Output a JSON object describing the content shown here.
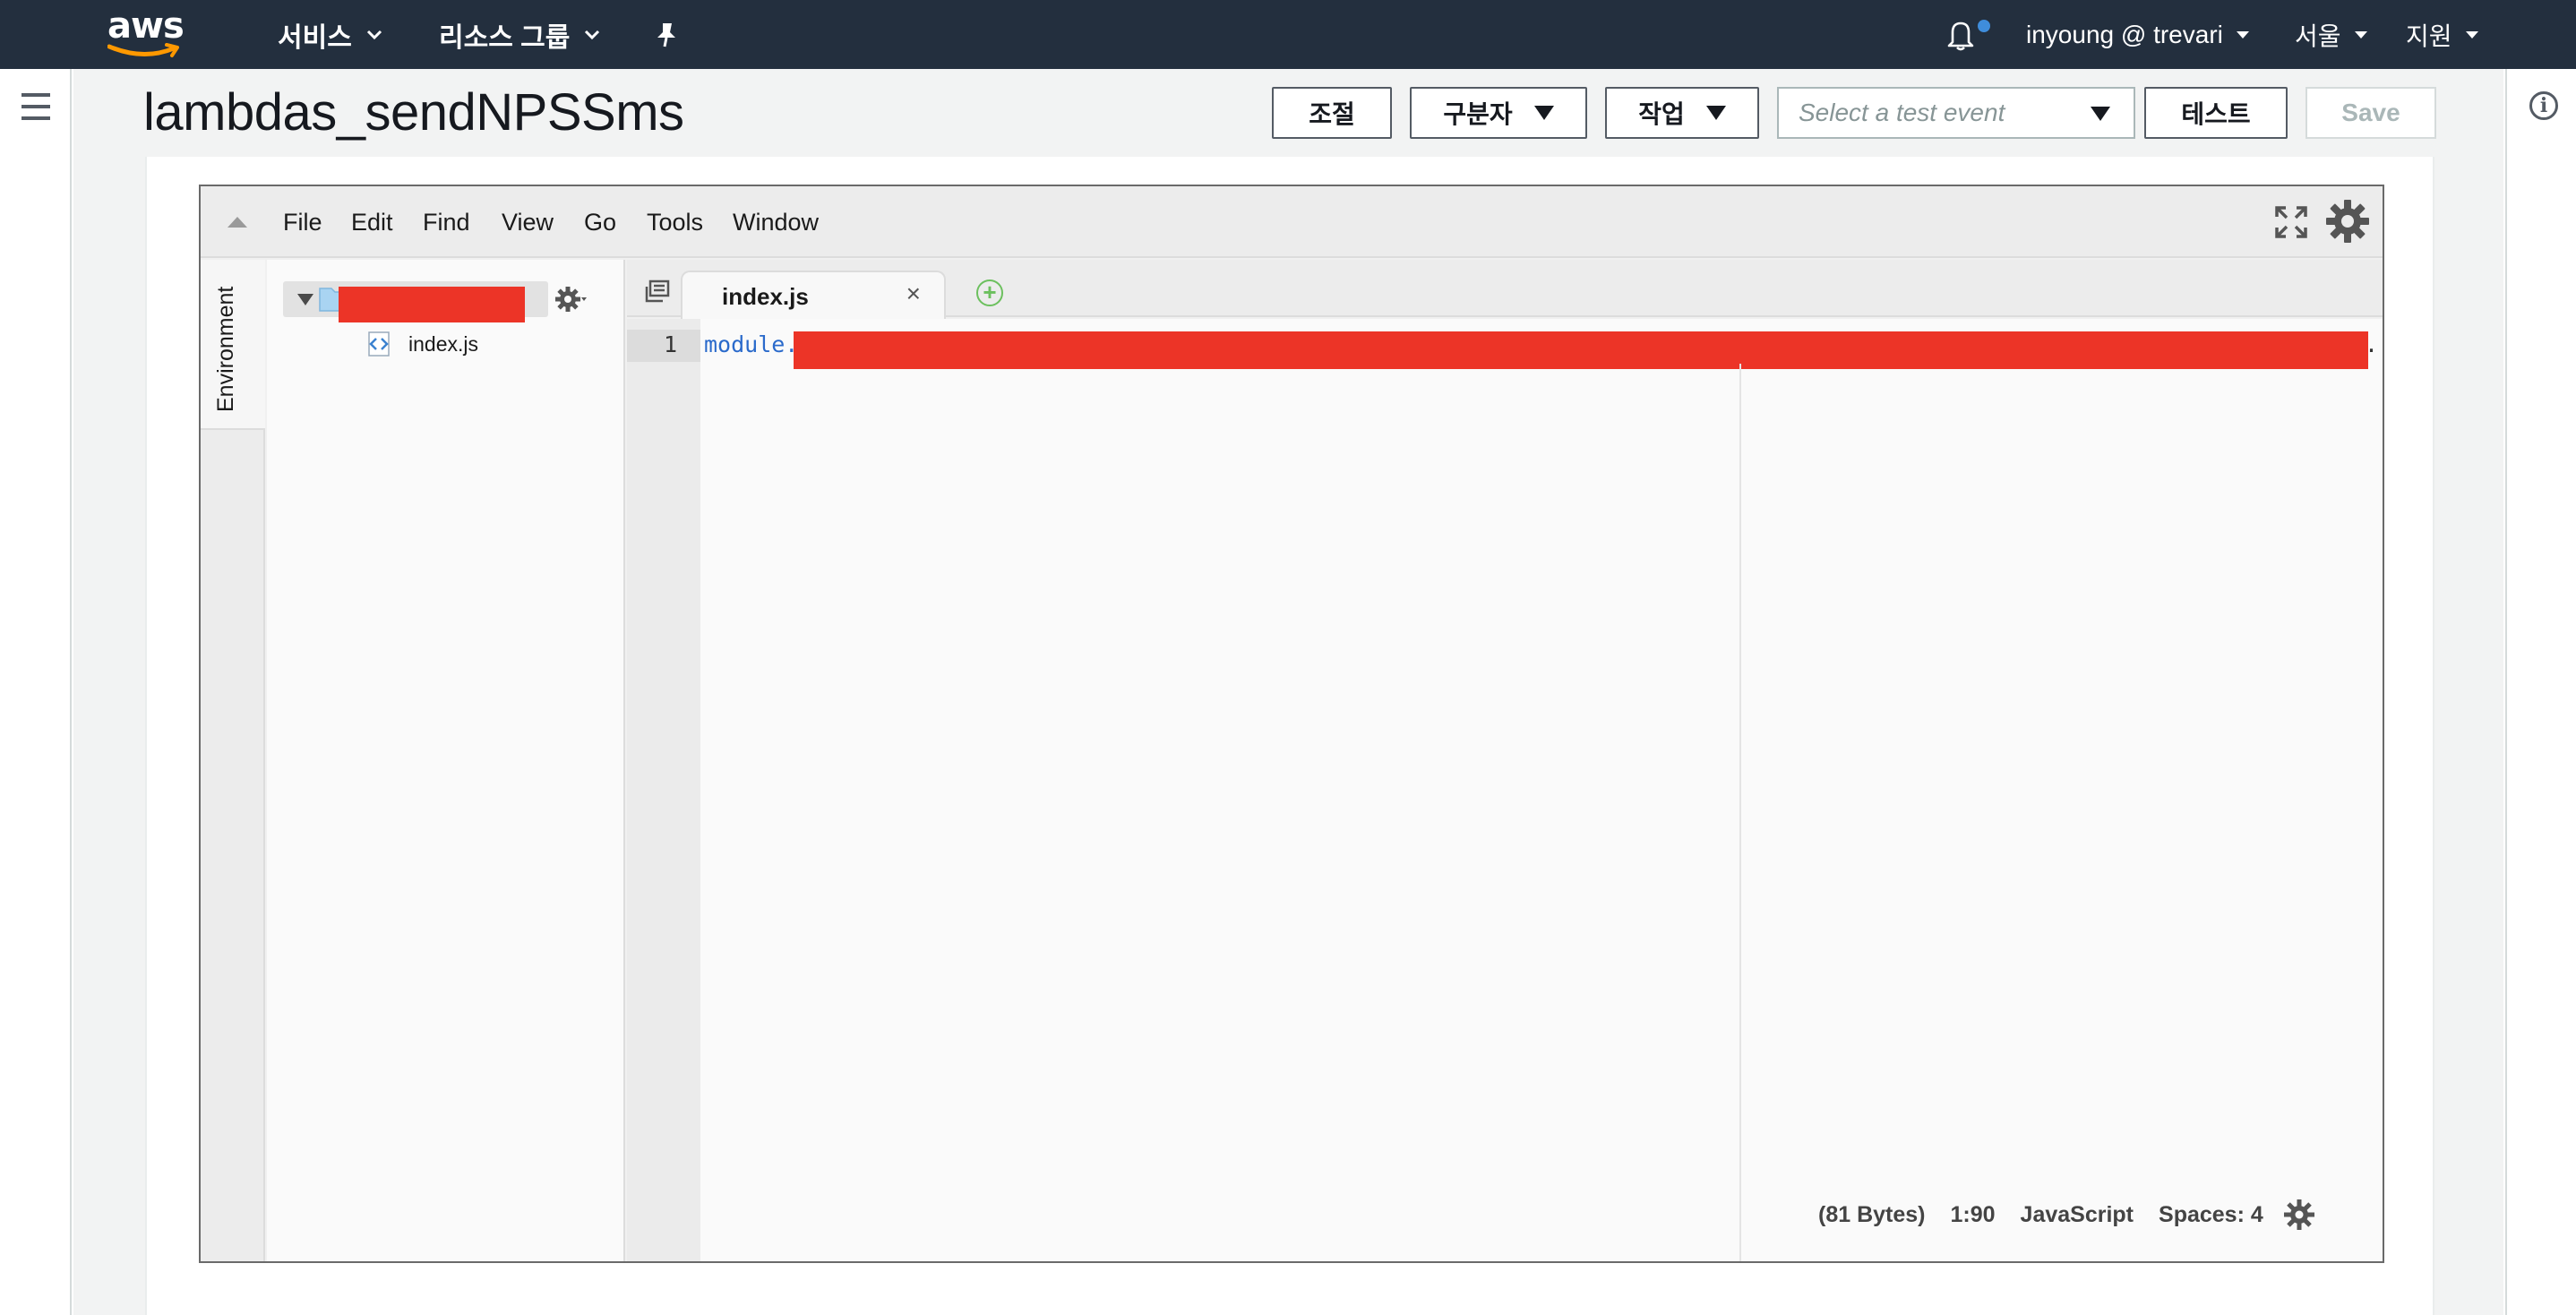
{
  "topnav": {
    "logo_text": "aws",
    "services_label": "서비스",
    "resource_groups_label": "리소스 그룹",
    "account_label": "inyoung @ trevari",
    "region_label": "서울",
    "support_label": "지원",
    "bg_color": "#232f3e",
    "logo_smile_color": "#ff9900"
  },
  "page": {
    "title": "lambdas_sendNPSSms"
  },
  "toolbar": {
    "throttle_label": "조절",
    "qualifiers_label": "구분자",
    "actions_label": "작업",
    "test_event_placeholder": "Select a test event",
    "test_label": "테스트",
    "save_label": "Save"
  },
  "ide": {
    "menu": [
      "File",
      "Edit",
      "Find",
      "View",
      "Go",
      "Tools",
      "Window"
    ],
    "environment_label": "Environment",
    "file_tree": {
      "files": [
        "index.js"
      ]
    },
    "tabs": [
      {
        "label": "index.js",
        "close": "×"
      }
    ],
    "add_tab": "+",
    "editor": {
      "line_number": "1",
      "code_visible_start": "module.",
      "code_visible_end": "."
    },
    "status": {
      "size": "(81 Bytes)",
      "position": "1:90",
      "language": "JavaScript",
      "spaces": "Spaces: 4"
    }
  },
  "colors": {
    "redaction": "#ec3427",
    "code_keyword": "#2a6acb",
    "add_tab": "#6cc05e",
    "notification_dot": "#3f8ddb"
  }
}
